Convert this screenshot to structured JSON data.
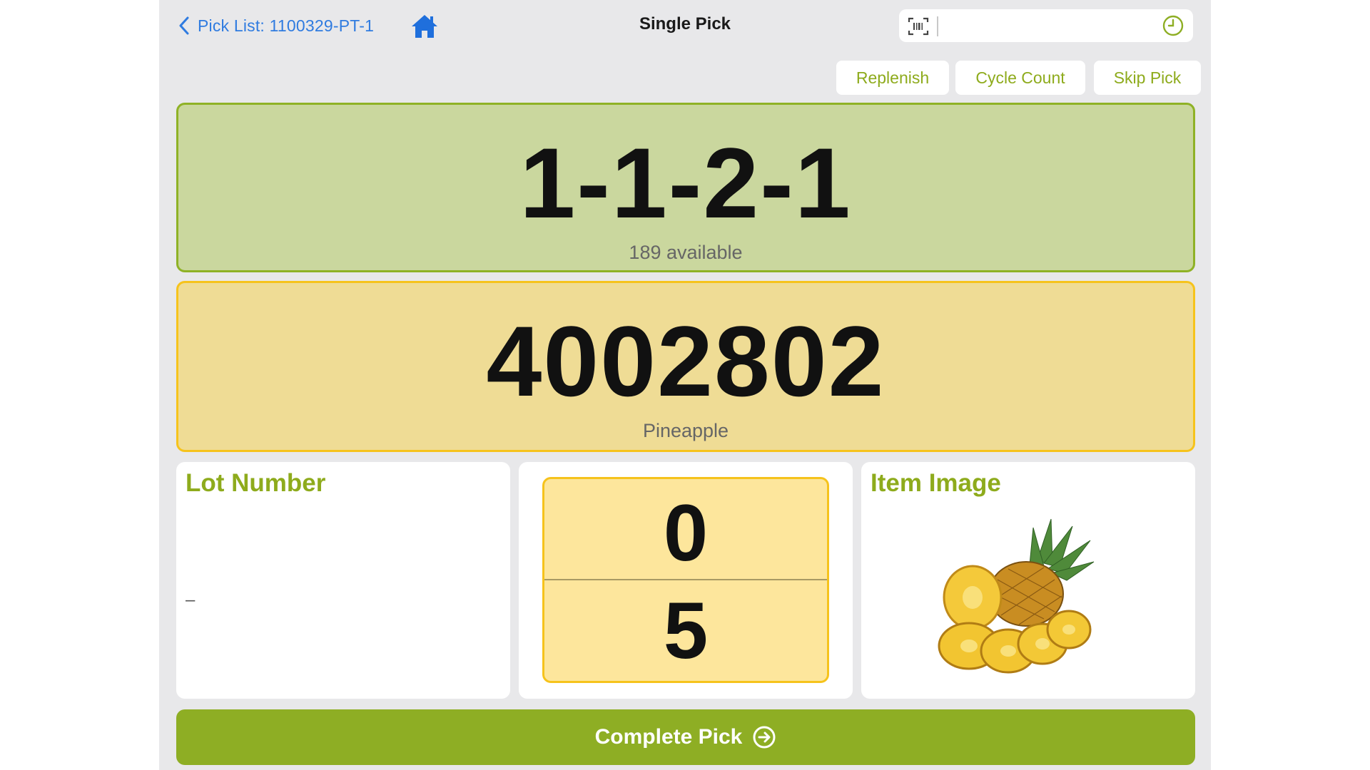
{
  "header": {
    "back_label": "Pick List: 1100329-PT-1",
    "title": "Single Pick",
    "scan_value": "",
    "icons": [
      "chevron-left-icon",
      "home-icon",
      "barcode-scan-icon",
      "history-clock-icon"
    ]
  },
  "actions": {
    "replenish": "Replenish",
    "cycle_count": "Cycle Count",
    "skip_pick": "Skip Pick"
  },
  "location": {
    "code": "1-1-2-1",
    "available": "189 available"
  },
  "item": {
    "number": "4002802",
    "name": "Pineapple"
  },
  "lot": {
    "heading": "Lot Number",
    "value": "–"
  },
  "quantity": {
    "picked": "0",
    "required": "5"
  },
  "image_card": {
    "heading": "Item Image",
    "image": "pineapple"
  },
  "complete_label": "Complete Pick",
  "colors": {
    "accent_green": "#8eae24",
    "link_blue": "#2f7be0",
    "location_bg": "#cad79e",
    "item_bg": "#efdc95",
    "qty_bg": "#fde69c",
    "border_yellow": "#f6c31c"
  }
}
